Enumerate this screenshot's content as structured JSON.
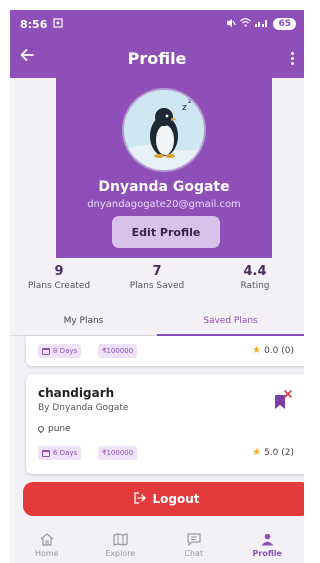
{
  "status": {
    "time": "8:56",
    "battery": "65"
  },
  "appbar": {
    "title": "Profile"
  },
  "profile": {
    "name": "Dnyanda Gogate",
    "email": "dnyandagogate20@gmail.com",
    "edit_label": "Edit Profile"
  },
  "stats": [
    {
      "value": "9",
      "label": "Plans Created"
    },
    {
      "value": "7",
      "label": "Plans Saved"
    },
    {
      "value": "4.4",
      "label": "Rating"
    }
  ],
  "tabs": [
    {
      "label": "My Plans",
      "active": false
    },
    {
      "label": "Saved Plans",
      "active": true
    }
  ],
  "plans": [
    {
      "days": "8 Days",
      "price": "₹100000",
      "rating": "0.0 (0)"
    },
    {
      "title": "chandigarh",
      "by": "By Dnyanda Gogate",
      "location": "pune",
      "days": "6 Days",
      "price": "₹100000",
      "rating": "5.0 (2)"
    }
  ],
  "logout": {
    "label": "Logout"
  },
  "nav": [
    {
      "label": "Home",
      "icon": "home-icon"
    },
    {
      "label": "Explore",
      "icon": "map-icon"
    },
    {
      "label": "Chat",
      "icon": "chat-icon"
    },
    {
      "label": "Profile",
      "icon": "person-icon",
      "active": true
    }
  ],
  "colors": {
    "primary": "#8e4fb9",
    "logout": "#e33b3b",
    "star": "#f2b01e"
  }
}
